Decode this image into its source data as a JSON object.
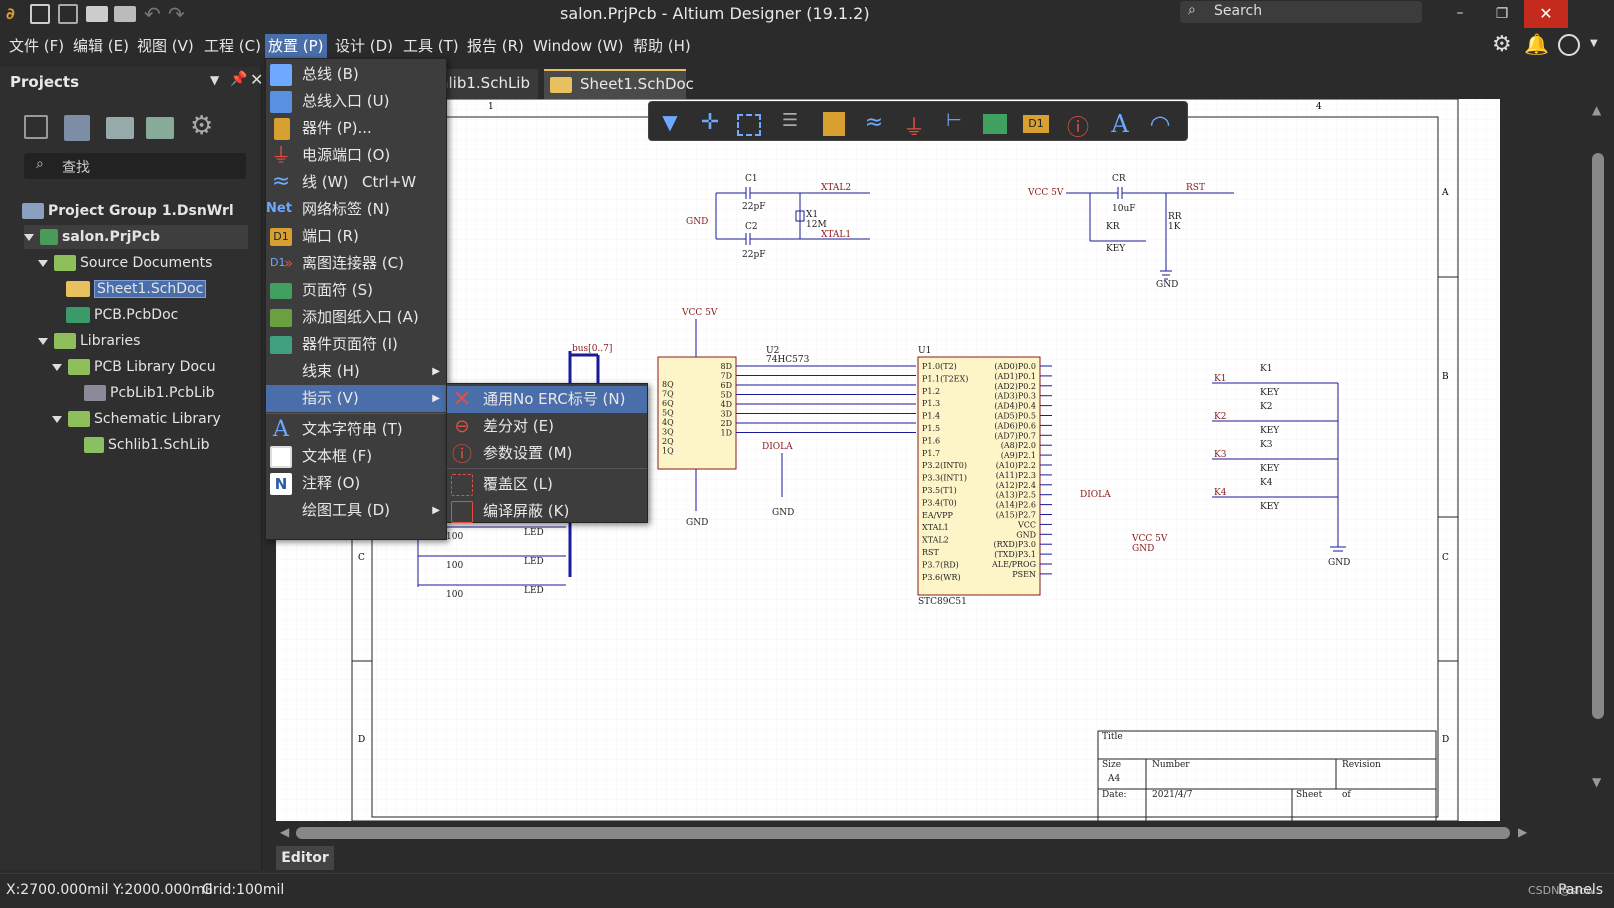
{
  "window": {
    "title": "salon.PrjPcb - Altium Designer (19.1.2)",
    "search_placeholder": "Search",
    "accent": "#4a6ea9",
    "close_color": "#c42b1c"
  },
  "menubar": [
    "文件 (F)",
    "编辑 (E)",
    "视图 (V)",
    "工程 (C)",
    "放置 (P)",
    "设计 (D)",
    "工具 (T)",
    "报告 (R)",
    "Window (W)",
    "帮助 (H)"
  ],
  "projects_panel": {
    "title": "Projects",
    "search_placeholder": "查找",
    "tree": [
      {
        "label": "Project Group 1.DsnWrl"
      },
      {
        "label": "salon.PrjPcb"
      },
      {
        "label": "Source Documents"
      },
      {
        "label": "Sheet1.SchDoc"
      },
      {
        "label": "PCB.PcbDoc"
      },
      {
        "label": "Libraries"
      },
      {
        "label": "PCB Library Docu"
      },
      {
        "label": "PcbLib1.PcbLib"
      },
      {
        "label": "Schematic Library"
      },
      {
        "label": "Schlib1.SchLib"
      }
    ]
  },
  "tabs": [
    "Schlib1.SchLib",
    "Sheet1.SchDoc"
  ],
  "place_menu": [
    {
      "label": "总线 (B)",
      "icon": "bus-icon"
    },
    {
      "label": "总线入口 (U)",
      "icon": "bus-entry-icon"
    },
    {
      "label": "器件 (P)...",
      "icon": "part-icon"
    },
    {
      "label": "电源端口 (O)",
      "icon": "power-port-icon"
    },
    {
      "label": "线 (W)",
      "shortcut": "Ctrl+W",
      "icon": "wire-icon"
    },
    {
      "label": "网络标签 (N)",
      "icon": "net-label-icon",
      "icon_text": "Net"
    },
    {
      "label": "端口 (R)",
      "icon": "port-icon",
      "icon_text": "D1"
    },
    {
      "label": "离图连接器 (C)",
      "icon": "off-sheet-connector-icon",
      "icon_text": "D1"
    },
    {
      "label": "页面符 (S)",
      "icon": "sheet-symbol-icon"
    },
    {
      "label": "添加图纸入口 (A)",
      "icon": "sheet-entry-icon"
    },
    {
      "label": "器件页面符 (I)",
      "icon": "device-sheet-icon"
    },
    {
      "label": "线束 (H)",
      "submenu": true
    },
    {
      "label": "指示 (V)",
      "submenu": true,
      "highlighted": true
    },
    {
      "label": "文本字符串 (T)",
      "icon": "text-string-icon",
      "icon_text": "A"
    },
    {
      "label": "文本框 (F)",
      "icon": "text-frame-icon"
    },
    {
      "label": "注释 (O)",
      "icon": "note-icon",
      "icon_text": "N"
    },
    {
      "label": "绘图工具 (D)",
      "submenu": true
    }
  ],
  "directives_submenu": [
    {
      "label": "通用No ERC标号 (N)",
      "icon": "no-erc-icon",
      "highlighted": true
    },
    {
      "label": "差分对 (E)",
      "icon": "diff-pair-icon"
    },
    {
      "label": "参数设置 (M)",
      "icon": "parameter-set-icon"
    },
    {
      "label": "覆盖区 (L)",
      "icon": "blanket-icon"
    },
    {
      "label": "编译屏蔽 (K)",
      "icon": "compile-mask-icon"
    }
  ],
  "editor_tab": "Editor",
  "statusbar": {
    "coords": "X:2700.000mil Y:2000.000mil",
    "grid": "Grid:100mil",
    "panels": "Panels",
    "watermark": "CSDN@slow"
  },
  "schematic": {
    "border_cols": [
      "1",
      "4"
    ],
    "border_rows": [
      "A",
      "B",
      "C",
      "D"
    ],
    "title_block": {
      "title": "Title",
      "size": "Size",
      "size_val": "A4",
      "number": "Number",
      "revision": "Revision",
      "date": "Date:",
      "date_val": "2021/4/7",
      "sheet": "Sheet",
      "of": "of"
    },
    "labels": {
      "c1": "C1",
      "c1v": "22pF",
      "c2": "C2",
      "c2v": "22pF",
      "x1": "X1",
      "x1v": "12M",
      "xtal1": "XTAL1",
      "xtal2": "XTAL2",
      "gnd": "GND",
      "vcc5v": "VCC 5V",
      "cr": "CR",
      "crv": "10uF",
      "rr": "RR",
      "rrv": "1K",
      "kr": "KR",
      "key": "KEY",
      "rst": "RST",
      "u2": "U2",
      "u2v": "74HC573",
      "u1": "U1",
      "u1v": "STC89C51",
      "diola": "DIOLA",
      "vcc": "VCC",
      "bus": "bus[0..7]",
      "k1": "K1",
      "k2": "K2",
      "k3": "K3",
      "k4": "K4",
      "led": "LED",
      "r100": "100"
    },
    "u2_pins_right": [
      "8D",
      "7D",
      "6D",
      "5D",
      "4D",
      "3D",
      "2D",
      "1D"
    ],
    "u2_pins_left": [
      "8Q",
      "7Q",
      "6Q",
      "5Q",
      "4Q",
      "3Q",
      "2Q",
      "1Q"
    ],
    "u1_pins_left": [
      "P1.0(T2)",
      "P1.1(T2EX)",
      "P1.2",
      "P1.3",
      "P1.4",
      "P1.5",
      "P1.6",
      "P1.7",
      "P3.2(INT0)",
      "P3.3(INT1)",
      "P3.5(T1)",
      "P3.4(T0)",
      "EA/VPP",
      "XTAL1",
      "XTAL2",
      "RST",
      "P3.7(RD)",
      "P3.6(WR)"
    ],
    "u1_pins_right": [
      "(AD0)P0.0",
      "(AD1)P0.1",
      "(AD2)P0.2",
      "(AD3)P0.3",
      "(AD4)P0.4",
      "(AD5)P0.5",
      "(AD6)P0.6",
      "(AD7)P0.7",
      "(A8)P2.0",
      "(A9)P2.1",
      "(A10)P2.2",
      "(A11)P2.3",
      "(A12)P2.4",
      "(A13)P2.5",
      "(A14)P2.6",
      "(A15)P2.7",
      "VCC",
      "GND",
      "(RXD)P3.0",
      "(TXD)P3.1",
      "ALE/PROG",
      "PSEN"
    ]
  }
}
